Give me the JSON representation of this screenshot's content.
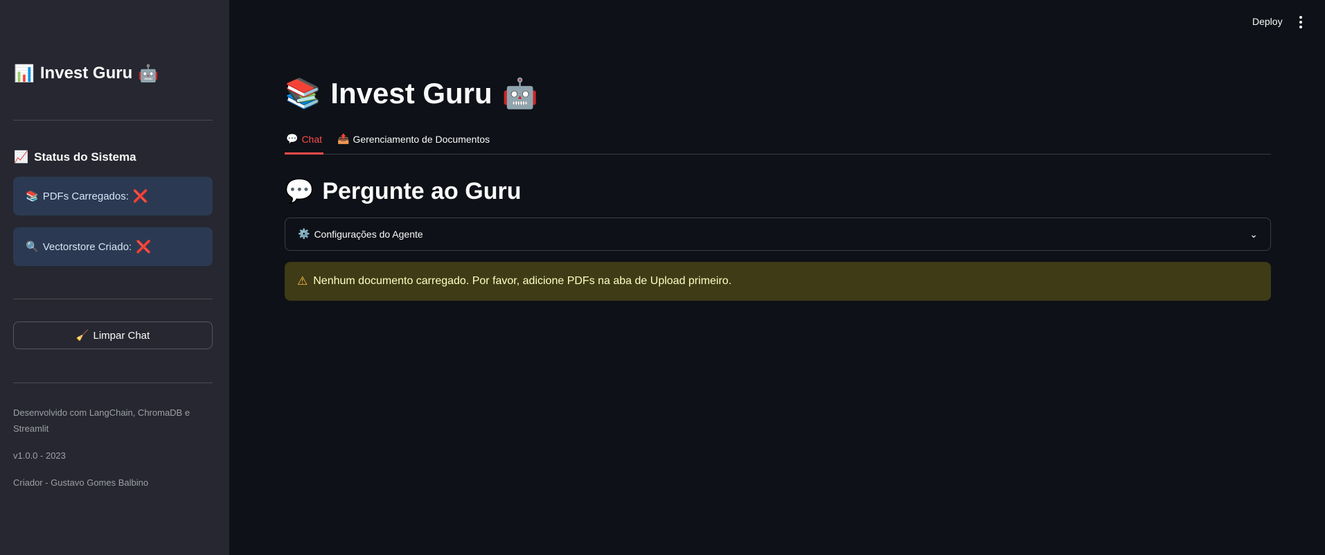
{
  "sidebar": {
    "title": "Invest Guru",
    "title_icon_left": "📊",
    "title_icon_right": "🤖",
    "status_title": "Status do Sistema",
    "status_icon": "📈",
    "status_items": [
      {
        "icon": "📚",
        "label": "PDFs Carregados:",
        "state": "❌"
      },
      {
        "icon": "🔍",
        "label": "Vectorstore Criado:",
        "state": "❌"
      }
    ],
    "clear_button": {
      "icon": "🧹",
      "label": "Limpar Chat"
    },
    "footer": {
      "line1": "Desenvolvido com LangChain, ChromaDB e Streamlit",
      "line2": "v1.0.0 - 2023",
      "line3": "Criador - Gustavo Gomes Balbino"
    }
  },
  "topbar": {
    "deploy_label": "Deploy"
  },
  "main": {
    "title": "Invest Guru",
    "title_icon_left": "📚",
    "title_icon_right": "🤖",
    "tabs": [
      {
        "icon": "💬",
        "label": "Chat",
        "active": true
      },
      {
        "icon": "📤",
        "label": "Gerenciamento de Documentos",
        "active": false
      }
    ],
    "subtitle": "Pergunte ao Guru",
    "subtitle_icon": "💬",
    "expander": {
      "icon": "⚙️",
      "label": "Configurações do Agente"
    },
    "warning": {
      "icon": "⚠",
      "text": "Nenhum documento carregado. Por favor, adicione PDFs na aba de Upload primeiro."
    }
  },
  "colors": {
    "accent": "#ff4b4b",
    "background": "#0e1117",
    "sidebar": "#262730",
    "warning_bg": "#3e3b16"
  }
}
